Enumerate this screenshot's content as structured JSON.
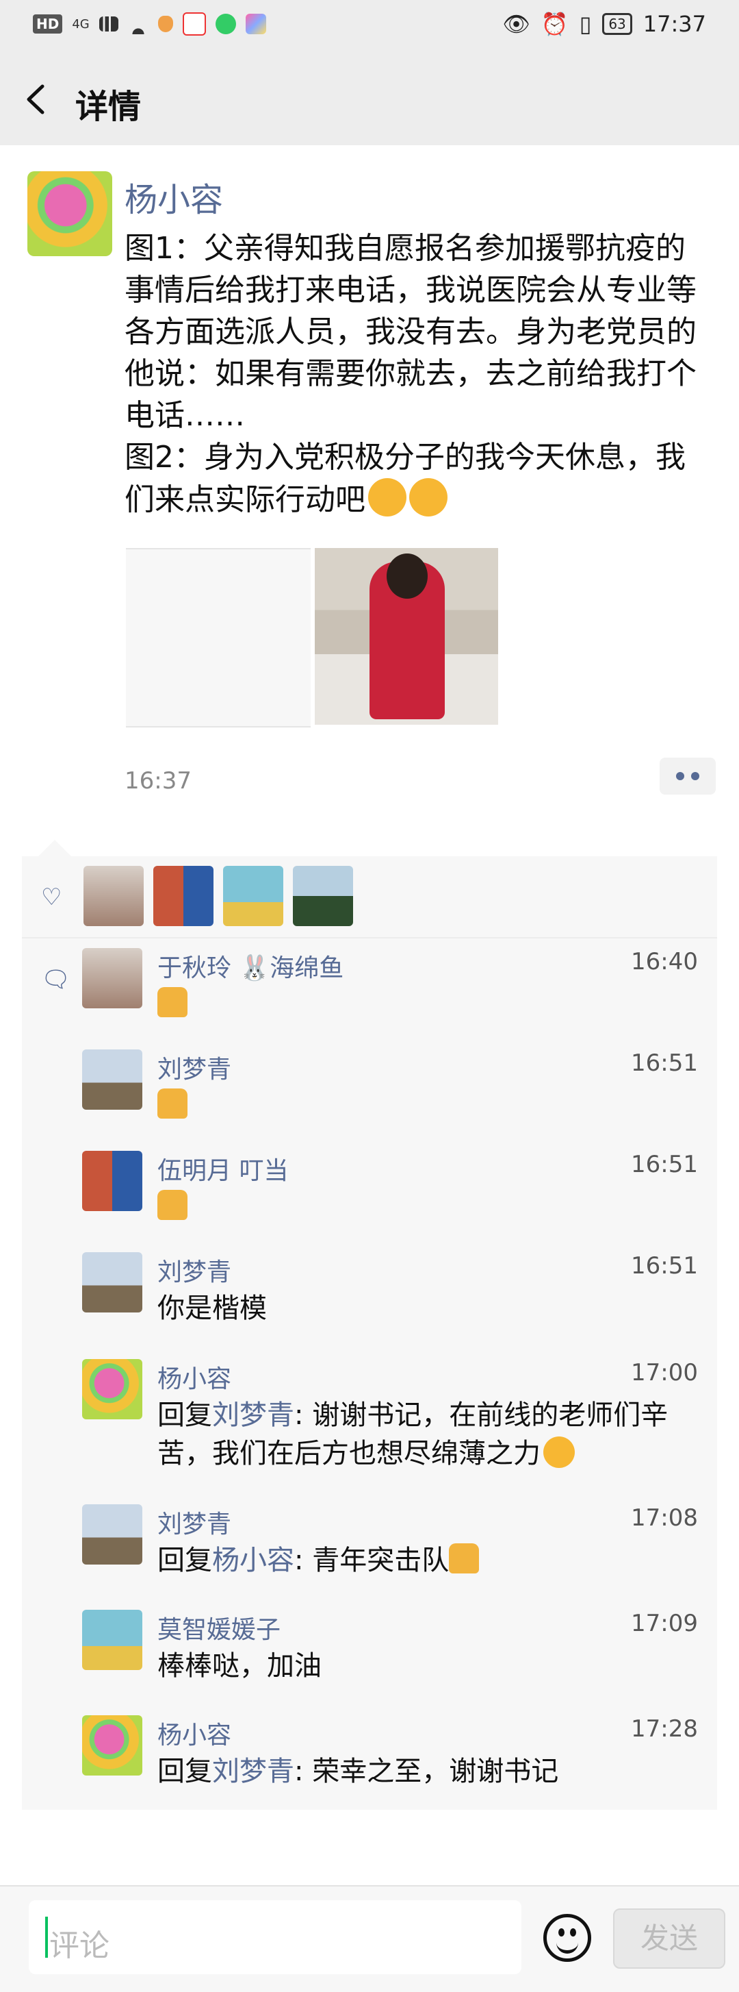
{
  "status_bar": {
    "network_badge": "HD",
    "signal": "4G",
    "battery": "63",
    "time": "17:37"
  },
  "header": {
    "back_icon": "chevron-left-icon",
    "title": "详情"
  },
  "post": {
    "author": "杨小容",
    "text_lines": [
      "图1：父亲得知我自愿报名参加援鄂抗疫的事情后给我打来电话，我说医院会从专业等各方面选派人员，我没有去。身为老党员的他说：如果有需要你就去，去之前给我打个电话……",
      "图2：身为入党积极分子的我今天休息，我们来点实际行动吧"
    ],
    "time": "16:37"
  },
  "likes": {
    "icon": "heart-icon"
  },
  "comments": [
    {
      "name": "于秋玲 🐰海绵鱼",
      "time": "16:40",
      "text": "",
      "emoji": "thumbs-up"
    },
    {
      "name": "刘梦青",
      "time": "16:51",
      "text": "",
      "emoji": "thumbs-up"
    },
    {
      "name": "伍明月  叮当",
      "time": "16:51",
      "text": "",
      "emoji": "thumbs-up"
    },
    {
      "name": "刘梦青",
      "time": "16:51",
      "text": "你是楷模"
    },
    {
      "name": "杨小容",
      "time": "17:00",
      "reply_prefix": "回复",
      "reply_to": "刘梦青",
      "text": ": 谢谢书记，在前线的老师们辛苦，我们在后方也想尽绵薄之力"
    },
    {
      "name": "刘梦青",
      "time": "17:08",
      "reply_prefix": "回复",
      "reply_to": "杨小容",
      "text": ": 青年突击队"
    },
    {
      "name": "莫智媛媛子",
      "time": "17:09",
      "text": "棒棒哒，加油"
    },
    {
      "name": "杨小容",
      "time": "17:28",
      "reply_prefix": "回复",
      "reply_to": "刘梦青",
      "text": ": 荣幸之至，谢谢书记"
    }
  ],
  "composer": {
    "placeholder": "评论",
    "send_label": "发送",
    "emoji_icon": "smiley-icon"
  },
  "colors": {
    "name_blue": "#576b95",
    "background_gray": "#ededed",
    "panel_gray": "#f7f7f7",
    "caret_green": "#07c160"
  }
}
